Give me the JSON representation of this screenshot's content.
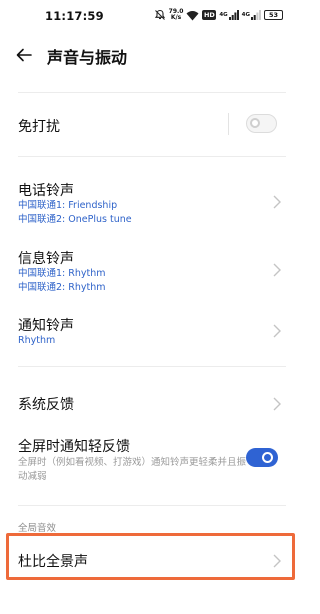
{
  "status_bar": {
    "time": "11:17:59",
    "network_speed": "79.0",
    "network_speed_unit": "K/s",
    "hd_badge": "HD",
    "signal1_tech": "4G",
    "signal2_tech": "4G",
    "battery": "53",
    "icons": [
      "mute-icon",
      "network-speed",
      "wifi-icon",
      "hd-badge",
      "signal-icon",
      "signal-icon",
      "battery-icon"
    ]
  },
  "header": {
    "title": "声音与振动",
    "back_icon": "back-arrow-icon"
  },
  "settings": {
    "dnd": {
      "label": "免打扰",
      "enabled": false
    },
    "phone_ringtone": {
      "label": "电话铃声",
      "sim1": "中国联通1: Friendship",
      "sim2": "中国联通2: OnePlus tune"
    },
    "message_ringtone": {
      "label": "信息铃声",
      "sim1": "中国联通1: Rhythm",
      "sim2": "中国联通2: Rhythm"
    },
    "notification_ringtone": {
      "label": "通知铃声",
      "value": "Rhythm"
    },
    "system_feedback": {
      "label": "系统反馈"
    },
    "fullscreen_notify": {
      "label": "全屏时通知轻反馈",
      "desc": "全屏时（例如看视频、打游戏）通知铃声更轻柔并且振动减弱",
      "enabled": true
    },
    "global_audio_section": "全局音效",
    "dolby": {
      "label": "杜比全景声"
    }
  },
  "colors": {
    "accent": "#2f63d3",
    "sub_text": "#2f63c9",
    "highlight": "#ee6a3a"
  }
}
